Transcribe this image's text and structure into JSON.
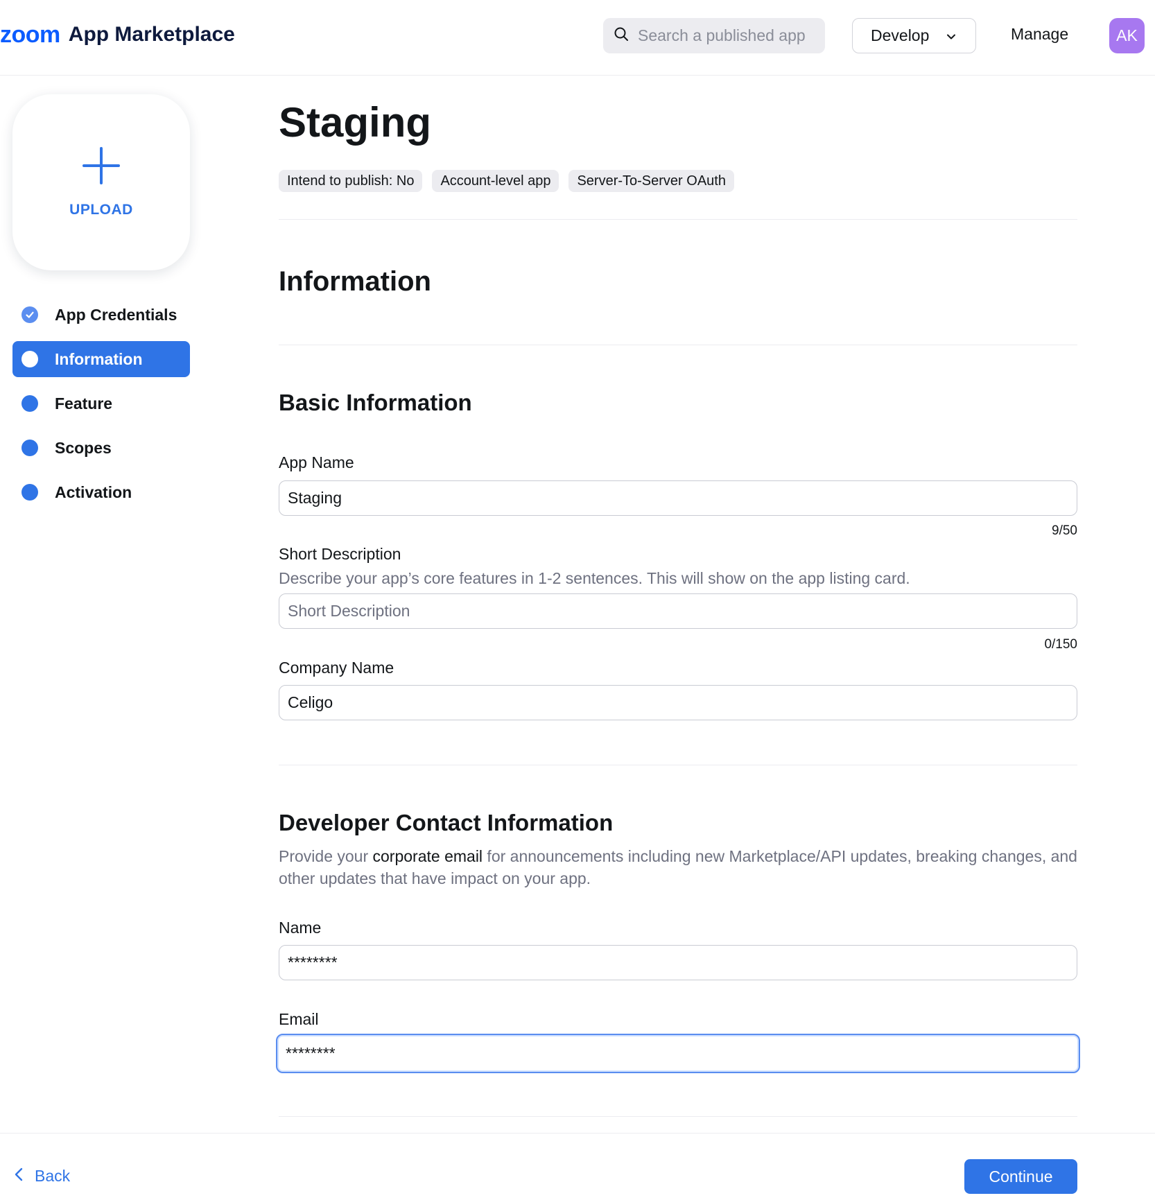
{
  "header": {
    "brand_logo": "zoom",
    "brand_name": "App Marketplace",
    "search_placeholder": "Search a published app",
    "develop_label": "Develop",
    "manage_label": "Manage",
    "avatar_initials": "AK"
  },
  "sidebar": {
    "upload_label": "UPLOAD",
    "steps": [
      {
        "label": "App Credentials",
        "state": "done"
      },
      {
        "label": "Information",
        "state": "active"
      },
      {
        "label": "Feature",
        "state": "pending"
      },
      {
        "label": "Scopes",
        "state": "pending"
      },
      {
        "label": "Activation",
        "state": "pending"
      }
    ]
  },
  "main": {
    "title": "Staging",
    "tags": [
      "Intend to publish: No",
      "Account-level app",
      "Server-To-Server OAuth"
    ],
    "section_title": "Information",
    "basic_info": {
      "heading": "Basic Information",
      "app_name_label": "App Name",
      "app_name_value": "Staging",
      "app_name_counter": "9/50",
      "short_desc_label": "Short Description",
      "short_desc_hint": "Describe your app’s core features in 1-2 sentences. This will show on the app listing card.",
      "short_desc_placeholder": "Short Description",
      "short_desc_value": "",
      "short_desc_counter": "0/150",
      "company_label": "Company Name",
      "company_value": "Celigo"
    },
    "developer_contact": {
      "heading": "Developer Contact Information",
      "hint_prefix": "Provide your ",
      "hint_emphasis": "corporate email",
      "hint_suffix": " for announcements including new Marketplace/API updates, breaking changes, and other updates that have impact on your app.",
      "name_label": "Name",
      "name_value": "********",
      "email_label": "Email",
      "email_value": "********"
    }
  },
  "footer": {
    "back_label": "Back",
    "continue_label": "Continue"
  },
  "colors": {
    "accent": "#2f74e6",
    "brand": "#0b5cff",
    "avatar": "#a778f0"
  }
}
